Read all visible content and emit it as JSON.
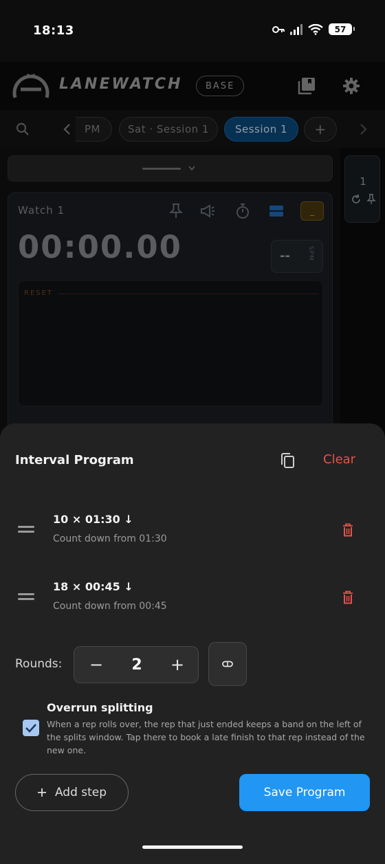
{
  "status": {
    "time": "18:13",
    "battery": "57"
  },
  "appbar": {
    "logo_text": "LANEWATCH",
    "badge": "BASE"
  },
  "tabs": {
    "items": [
      {
        "label": "PM"
      },
      {
        "label": "Sat · Session 1"
      },
      {
        "label": "Session 1",
        "active": true
      }
    ],
    "add_label": "+"
  },
  "side_card": {
    "number": "1"
  },
  "watch": {
    "title": "Watch 1",
    "time": "00:00.00",
    "spm_value": "--",
    "spm_label": "SPM",
    "tool_badge": "_",
    "reset_label": "RESET"
  },
  "sheet": {
    "title": "Interval Program",
    "clear_label": "Clear",
    "steps": [
      {
        "title": "10 × 01:30 ↓",
        "subtitle": "Count down from 01:30"
      },
      {
        "title": "18 × 00:45 ↓",
        "subtitle": "Count down from 00:45"
      }
    ],
    "rounds_label": "Rounds:",
    "rounds_value": "2",
    "minus_label": "−",
    "plus_label": "+",
    "overrun_title": "Overrun splitting",
    "overrun_description": "When a rep rolls over, the rep that just ended keeps a band on the left of the splits window. Tap there to book a late finish to that rep instead of the new one.",
    "overrun_checked": true,
    "add_step_label": "Add step",
    "save_label": "Save Program"
  },
  "colors": {
    "accent": "#2196f3",
    "danger": "#e5534b",
    "sheet_bg": "#222222",
    "active_tab": "#0b4c80"
  }
}
